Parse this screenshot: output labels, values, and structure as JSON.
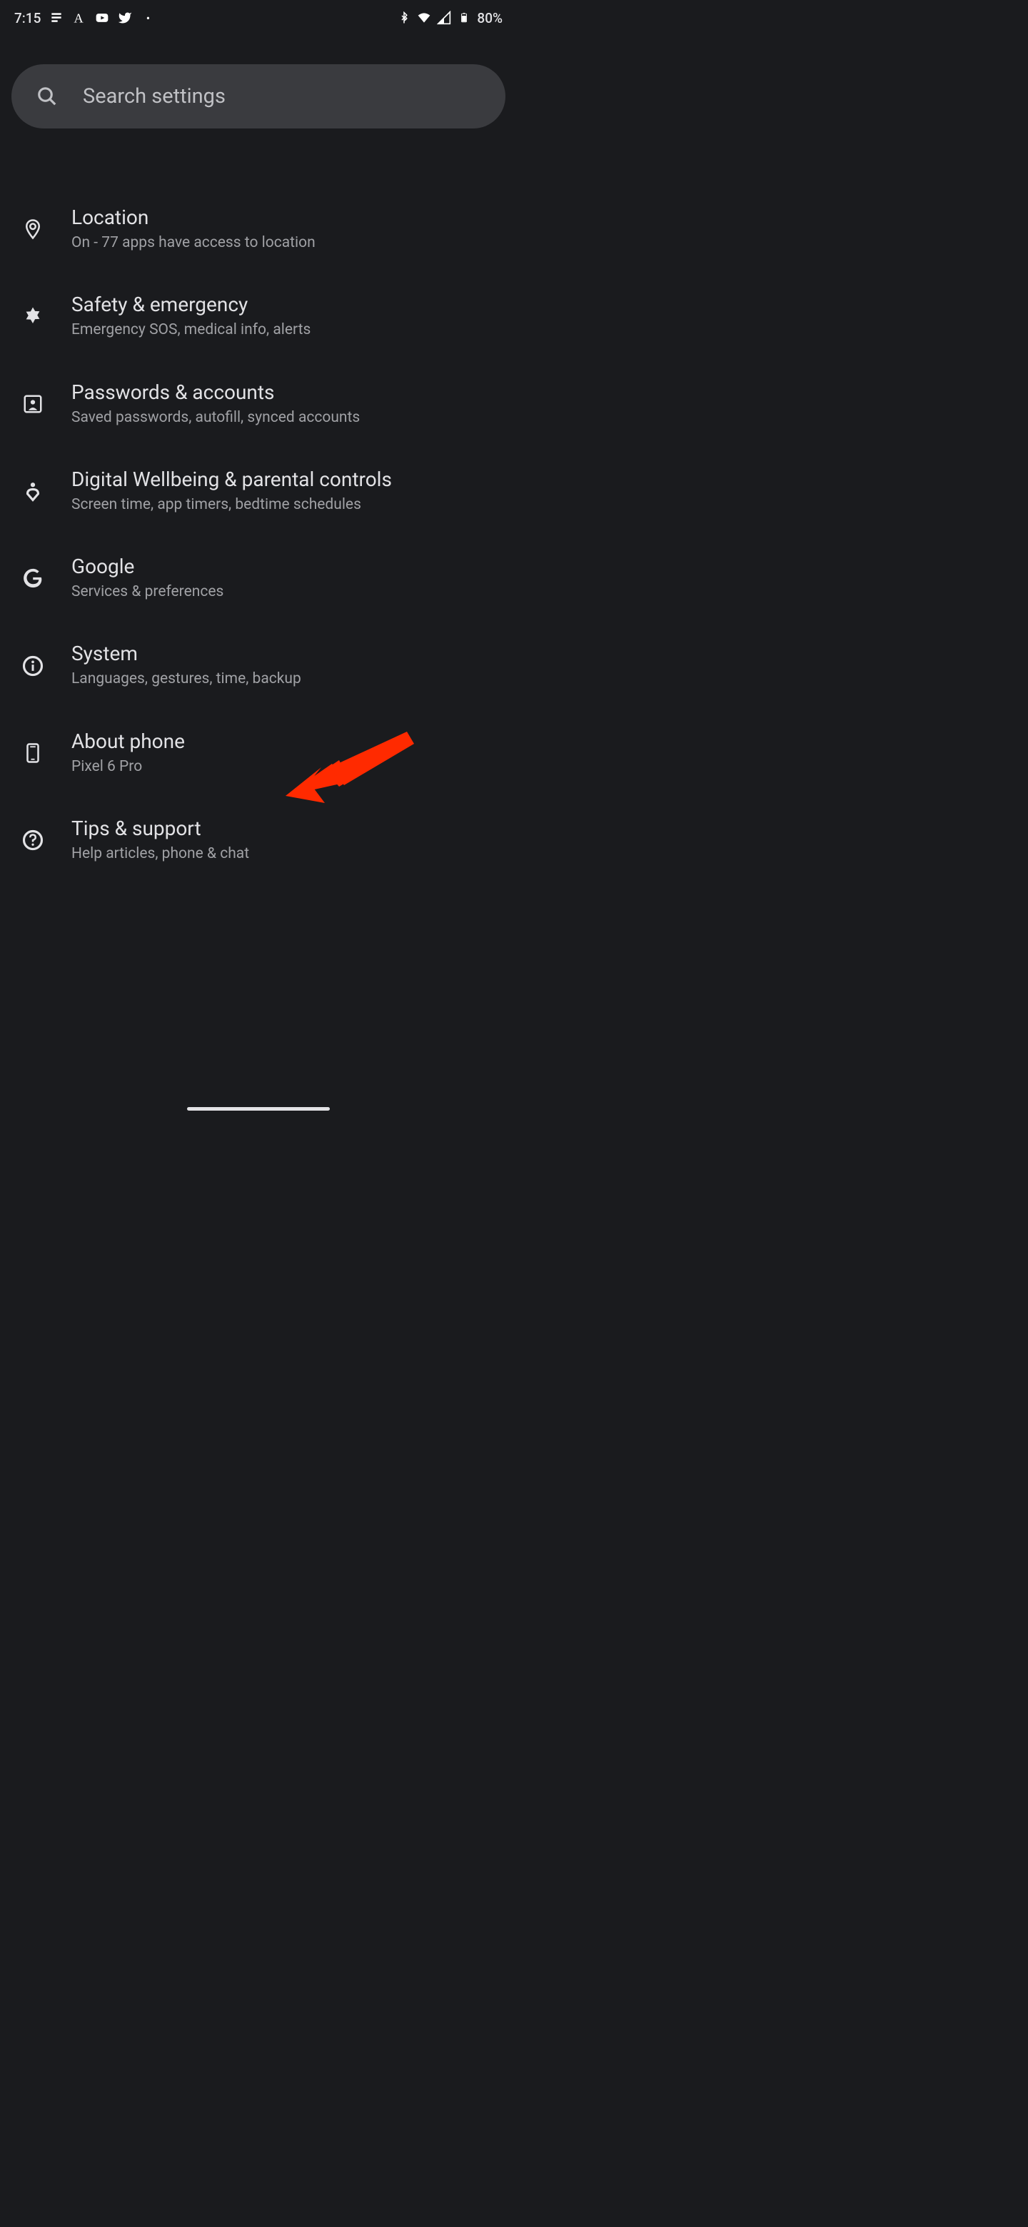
{
  "status_bar": {
    "time": "7:15",
    "battery": "80%"
  },
  "search": {
    "placeholder": "Search settings"
  },
  "settings": [
    {
      "id": "location",
      "title": "Location",
      "subtitle": "On - 77 apps have access to location"
    },
    {
      "id": "safety",
      "title": "Safety & emergency",
      "subtitle": "Emergency SOS, medical info, alerts"
    },
    {
      "id": "passwords",
      "title": "Passwords & accounts",
      "subtitle": "Saved passwords, autofill, synced accounts"
    },
    {
      "id": "wellbeing",
      "title": "Digital Wellbeing & parental controls",
      "subtitle": "Screen time, app timers, bedtime schedules"
    },
    {
      "id": "google",
      "title": "Google",
      "subtitle": "Services & preferences"
    },
    {
      "id": "system",
      "title": "System",
      "subtitle": "Languages, gestures, time, backup"
    },
    {
      "id": "about",
      "title": "About phone",
      "subtitle": "Pixel 6 Pro"
    },
    {
      "id": "tips",
      "title": "Tips & support",
      "subtitle": "Help articles, phone & chat"
    }
  ]
}
